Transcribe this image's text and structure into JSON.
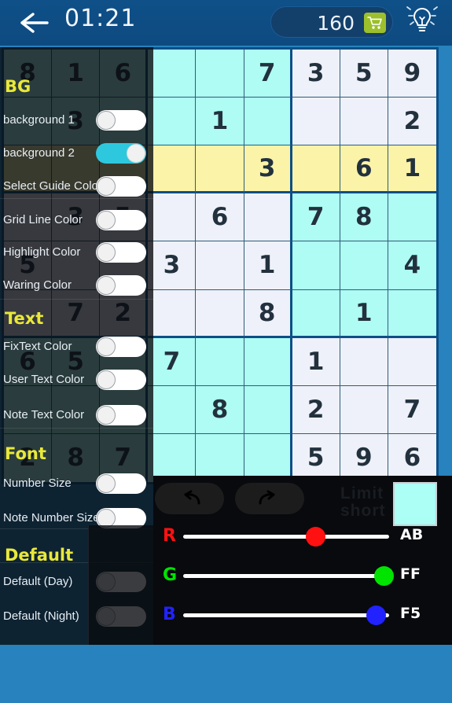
{
  "topbar": {
    "back_icon": "back-arrow-icon",
    "timer": "01:21",
    "coin_count": "160",
    "cart_icon": "shopping-cart-icon",
    "hint_icon": "lightbulb-icon",
    "hint_label": "hint"
  },
  "board": {
    "colors": {
      "plain": "#eef1f9",
      "cyan": "#aefcf3",
      "yellow": "#fbf3a8",
      "grid_line": "#2e5c79",
      "box_line": "#0d4f86",
      "text": "#22313d"
    },
    "rows": [
      [
        "8",
        "1",
        "6",
        "",
        "",
        "7",
        "3",
        "5",
        "9"
      ],
      [
        "",
        "3",
        "4",
        "",
        "1",
        "",
        "",
        "",
        "2"
      ],
      [
        "",
        "",
        "",
        "",
        "",
        "3",
        "",
        "6",
        "1"
      ],
      [
        "",
        "3",
        "5",
        "",
        "6",
        "",
        "7",
        "8",
        ""
      ],
      [
        "5",
        "",
        "",
        "3",
        "",
        "1",
        "",
        "",
        "4"
      ],
      [
        "",
        "7",
        "2",
        "",
        "",
        "8",
        "",
        "1",
        ""
      ],
      [
        "6",
        "5",
        "",
        "7",
        "",
        "",
        "1",
        "",
        ""
      ],
      [
        "",
        "",
        "",
        "",
        "8",
        "",
        "2",
        "",
        "7"
      ],
      [
        "2",
        "8",
        "7",
        "",
        "",
        "",
        "5",
        "9",
        "6"
      ]
    ],
    "backgrounds": [
      [
        "c",
        "c",
        "c",
        "c",
        "c",
        "c",
        "p",
        "p",
        "p"
      ],
      [
        "c",
        "c",
        "c",
        "c",
        "c",
        "c",
        "p",
        "p",
        "p"
      ],
      [
        "y",
        "y",
        "y",
        "y",
        "y",
        "y",
        "y",
        "y",
        "y"
      ],
      [
        "p",
        "p",
        "p",
        "p",
        "p",
        "p",
        "c",
        "c",
        "c"
      ],
      [
        "p",
        "p",
        "p",
        "p",
        "p",
        "p",
        "c",
        "c",
        "c"
      ],
      [
        "p",
        "p",
        "p",
        "p",
        "p",
        "p",
        "c",
        "c",
        "c"
      ],
      [
        "c",
        "c",
        "c",
        "c",
        "c",
        "c",
        "p",
        "p",
        "p"
      ],
      [
        "c",
        "c",
        "c",
        "c",
        "c",
        "c",
        "p",
        "p",
        "p"
      ],
      [
        "c",
        "c",
        "c",
        "c",
        "c",
        "c",
        "p",
        "p",
        "p"
      ]
    ]
  },
  "settings": {
    "sections": [
      {
        "title": "BG",
        "options": [
          {
            "label": "background 1",
            "state": "off"
          },
          {
            "label": "background 2",
            "state": "on"
          },
          {
            "label": "Select Guide Color",
            "state": "off"
          }
        ]
      },
      {
        "title": "",
        "options": [
          {
            "label": "Grid Line Color",
            "state": "off"
          },
          {
            "label": "Highlight Color",
            "state": "off"
          },
          {
            "label": "Waring Color",
            "state": "off"
          }
        ]
      },
      {
        "title": "Text",
        "options": [
          {
            "label": "FixText Color",
            "state": "off"
          },
          {
            "label": "User Text Color",
            "state": "off"
          },
          {
            "label": "Note Text Color",
            "state": "off"
          }
        ]
      },
      {
        "title": "Font",
        "options": [
          {
            "label": "Number  Size",
            "state": "off"
          },
          {
            "label": "Note Number Size",
            "state": "off"
          }
        ]
      },
      {
        "title": "Default",
        "options": [
          {
            "label": "Default (Day)",
            "state": "off"
          },
          {
            "label": "Default (Night)",
            "state": "off"
          }
        ]
      }
    ]
  },
  "controls": {
    "undo_icon": "undo-arrow-icon",
    "redo_icon": "redo-arrow-icon",
    "ghost_text": "Limit\nshort",
    "preview_color": "#abfff5",
    "sliders": [
      {
        "channel": "R",
        "value": "AB",
        "percent": 67,
        "color": "#ff1111"
      },
      {
        "channel": "G",
        "value": "FF",
        "percent": 100,
        "color": "#00e400"
      },
      {
        "channel": "B",
        "value": "F5",
        "percent": 96,
        "color": "#2222ff"
      }
    ]
  }
}
